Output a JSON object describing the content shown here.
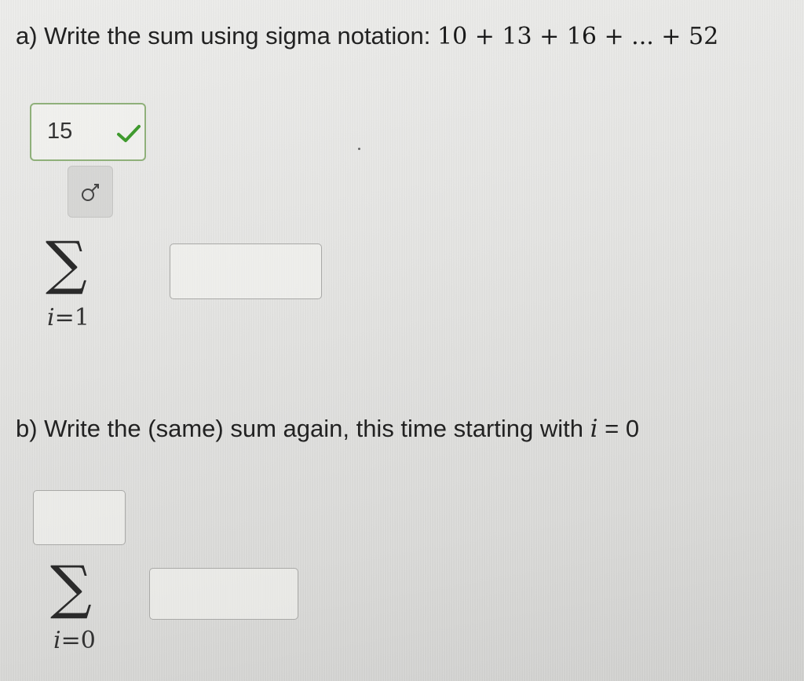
{
  "part_a": {
    "prompt": "a) Write the sum using sigma notation: ",
    "series": "10 + 13 + 16 + ... + 52",
    "upper_limit_value": "15",
    "lower_limit_var": "i",
    "lower_limit_eq": "=1",
    "sigma_symbol": "∑",
    "expression_value": ""
  },
  "part_b": {
    "prompt": "b) Write the (same) sum again, this time starting with ",
    "var": "i",
    "condition": " = 0",
    "upper_limit_value": "",
    "lower_limit_var": "i",
    "lower_limit_eq": "=0",
    "sigma_symbol": "∑",
    "expression_value": ""
  },
  "colors": {
    "check": "#3f9a2e",
    "correct_border": "#8fb07a"
  },
  "icons": {
    "correct": "check-icon",
    "format": "gender-symbol-icon"
  }
}
